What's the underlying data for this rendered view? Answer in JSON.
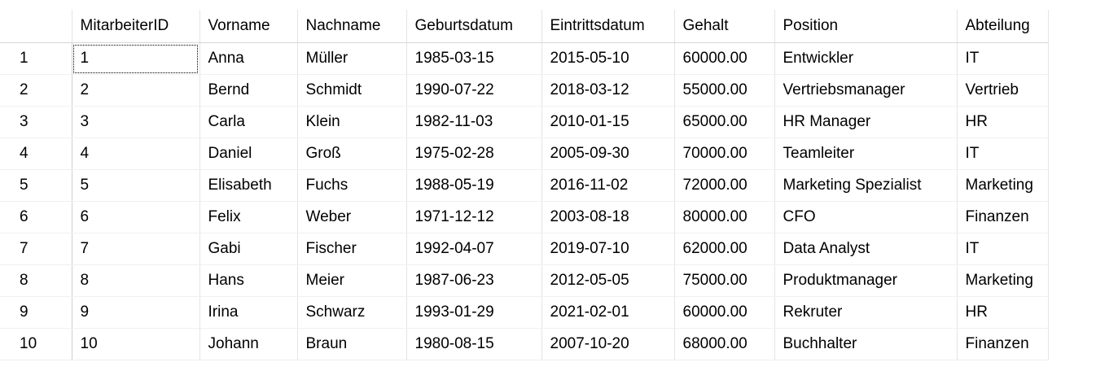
{
  "columns": [
    "MitarbeiterID",
    "Vorname",
    "Nachname",
    "Geburtsdatum",
    "Eintrittsdatum",
    "Gehalt",
    "Position",
    "Abteilung"
  ],
  "rows": [
    {
      "n": "1",
      "c": [
        "1",
        "Anna",
        "Müller",
        "1985-03-15",
        "2015-05-10",
        "60000.00",
        "Entwickler",
        "IT"
      ]
    },
    {
      "n": "2",
      "c": [
        "2",
        "Bernd",
        "Schmidt",
        "1990-07-22",
        "2018-03-12",
        "55000.00",
        "Vertriebsmanager",
        "Vertrieb"
      ]
    },
    {
      "n": "3",
      "c": [
        "3",
        "Carla",
        "Klein",
        "1982-11-03",
        "2010-01-15",
        "65000.00",
        "HR Manager",
        "HR"
      ]
    },
    {
      "n": "4",
      "c": [
        "4",
        "Daniel",
        "Groß",
        "1975-02-28",
        "2005-09-30",
        "70000.00",
        "Teamleiter",
        "IT"
      ]
    },
    {
      "n": "5",
      "c": [
        "5",
        "Elisabeth",
        "Fuchs",
        "1988-05-19",
        "2016-11-02",
        "72000.00",
        "Marketing Spezialist",
        "Marketing"
      ]
    },
    {
      "n": "6",
      "c": [
        "6",
        "Felix",
        "Weber",
        "1971-12-12",
        "2003-08-18",
        "80000.00",
        "CFO",
        "Finanzen"
      ]
    },
    {
      "n": "7",
      "c": [
        "7",
        "Gabi",
        "Fischer",
        "1992-04-07",
        "2019-07-10",
        "62000.00",
        "Data Analyst",
        "IT"
      ]
    },
    {
      "n": "8",
      "c": [
        "8",
        "Hans",
        "Meier",
        "1987-06-23",
        "2012-05-05",
        "75000.00",
        "Produktmanager",
        "Marketing"
      ]
    },
    {
      "n": "9",
      "c": [
        "9",
        "Irina",
        "Schwarz",
        "1993-01-29",
        "2021-02-01",
        "60000.00",
        "Rekruter",
        "HR"
      ]
    },
    {
      "n": "10",
      "c": [
        "10",
        "Johann",
        "Braun",
        "1980-08-15",
        "2007-10-20",
        "68000.00",
        "Buchhalter",
        "Finanzen"
      ]
    }
  ]
}
